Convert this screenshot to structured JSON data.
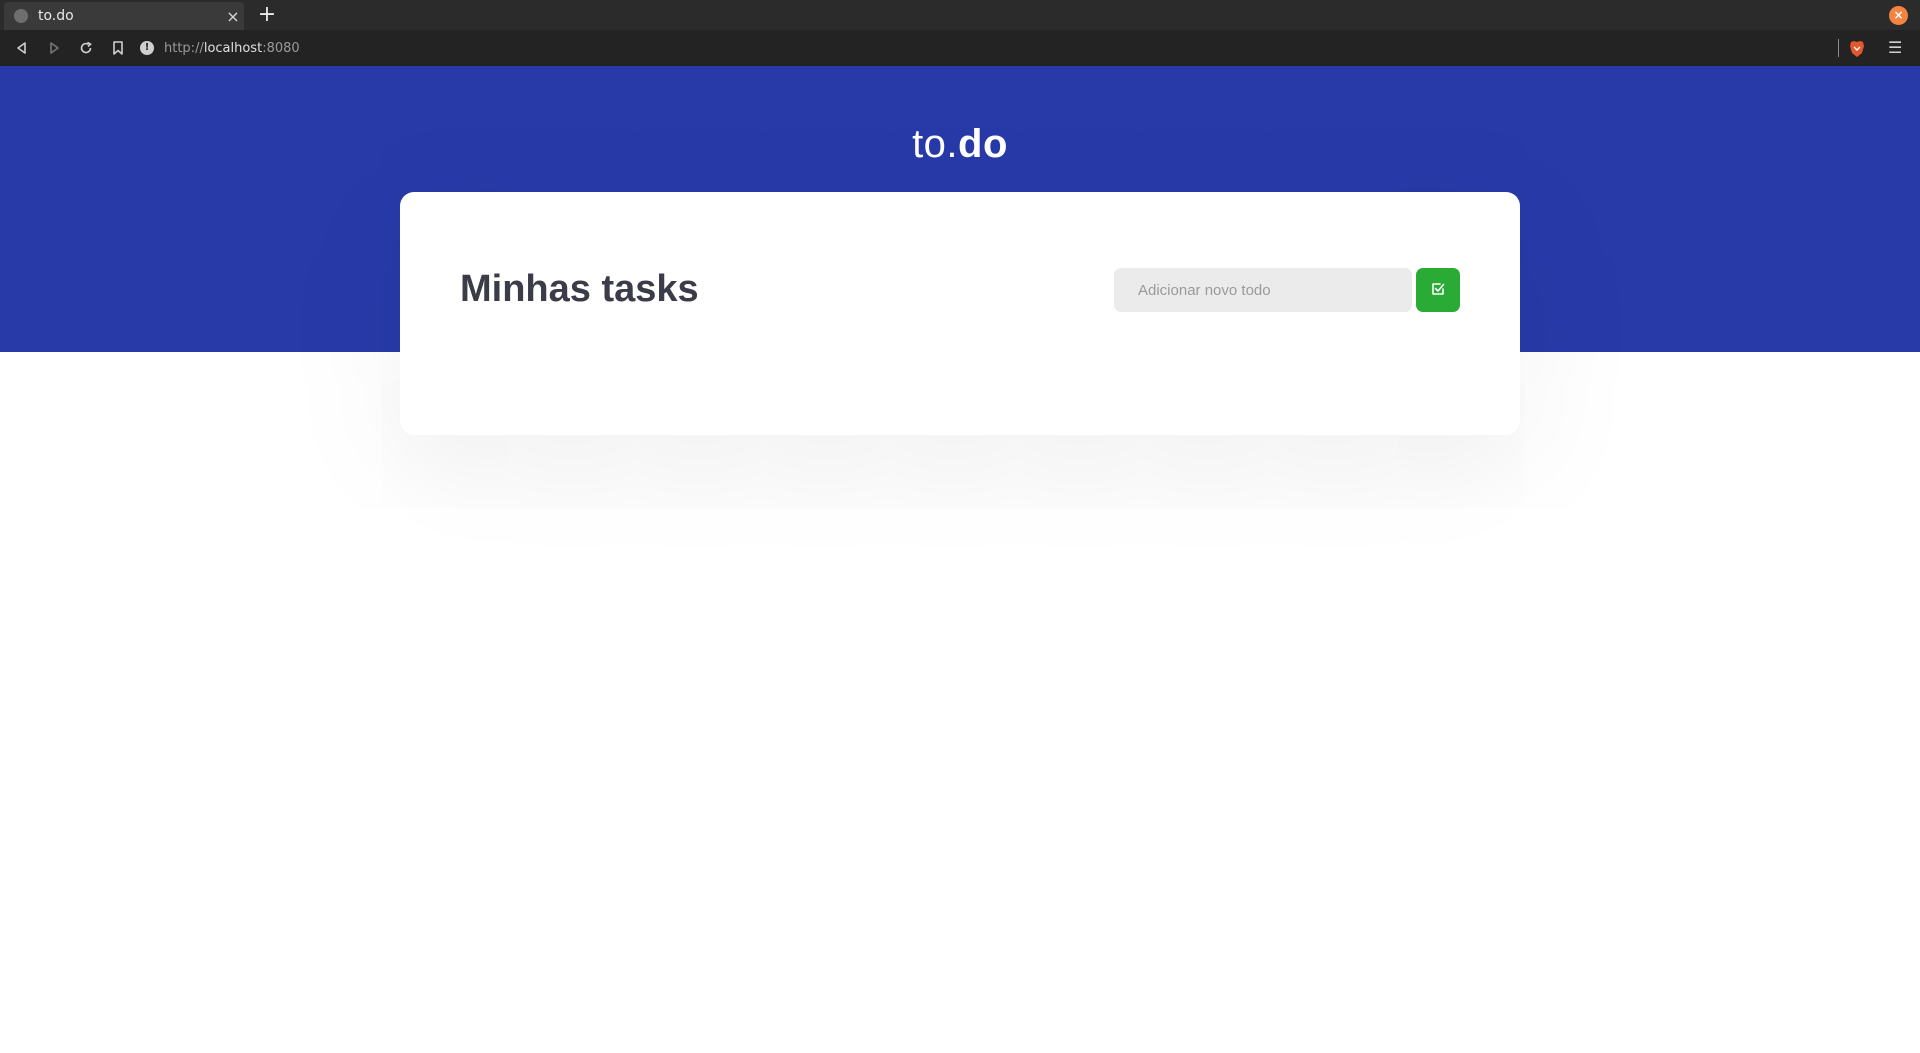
{
  "browser": {
    "tab_title": "to.do",
    "tab_close": "×",
    "new_tab": "+",
    "url_scheme": "http://",
    "url_host": "localhost",
    "url_port": ":8080",
    "info_glyph": "!",
    "menu_glyph": "☰",
    "window_close": "×",
    "nav_icons": [
      "back-icon",
      "forward-icon",
      "reload-icon",
      "bookmark-icon"
    ]
  },
  "header": {
    "brand_light": "to.",
    "brand_bold": "do"
  },
  "tasks": {
    "title": "Minhas tasks",
    "input_placeholder": "Adicionar novo todo",
    "input_value": "",
    "add_icon": "check-square-icon"
  },
  "colors": {
    "hero": "#273aa8",
    "add_button": "#2aab36",
    "title_text": "#3c3c49",
    "input_bg": "#ebebeb"
  }
}
